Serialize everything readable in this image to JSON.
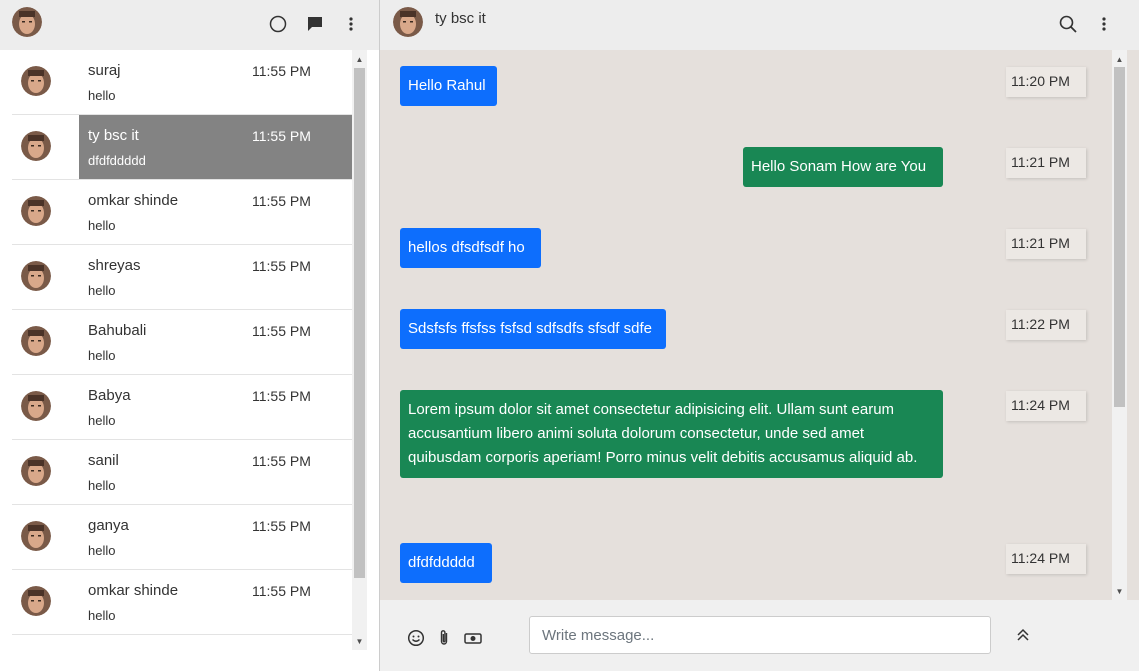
{
  "user": {
    "avatar_icon": "user-avatar"
  },
  "left_header": {
    "icons": [
      "status-icon",
      "new-chat-icon",
      "menu-icon"
    ]
  },
  "chats": [
    {
      "name": "suraj",
      "time": "11:55 PM",
      "last": "hello",
      "active": false
    },
    {
      "name": "ty bsc it",
      "time": "11:55 PM",
      "last": "dfdfddddd",
      "active": true
    },
    {
      "name": "omkar shinde",
      "time": "11:55 PM",
      "last": "hello",
      "active": false
    },
    {
      "name": "shreyas",
      "time": "11:55 PM",
      "last": "hello",
      "active": false
    },
    {
      "name": "Bahubali",
      "time": "11:55 PM",
      "last": "hello",
      "active": false
    },
    {
      "name": "Babya",
      "time": "11:55 PM",
      "last": "hello",
      "active": false
    },
    {
      "name": "sanil",
      "time": "11:55 PM",
      "last": "hello",
      "active": false
    },
    {
      "name": "ganya",
      "time": "11:55 PM",
      "last": "hello",
      "active": false
    },
    {
      "name": "omkar shinde",
      "time": "11:55 PM",
      "last": "hello",
      "active": false
    }
  ],
  "conversation": {
    "title": "ty bsc it",
    "messages": [
      {
        "text": "Hello Rahul",
        "time": "11:20 PM",
        "color": "#0d6efd"
      },
      {
        "text": "Hello Sonam How are You",
        "time": "11:21 PM",
        "color": "#198754"
      },
      {
        "text": "hellos dfsdfsdf ho",
        "time": "11:21 PM",
        "color": "#0d6efd"
      },
      {
        "text": "Sdsfsfs ffsfss fsfsd sdfsdfs sfsdf sdfe",
        "time": "11:22 PM",
        "color": "#0d6efd"
      },
      {
        "text": "Lorem ipsum dolor sit amet consectetur adipisicing elit. Ullam sunt earum accusantium libero animi soluta dolorum consectetur, unde sed amet quibusdam corporis aperiam! Porro minus velit debitis accusamus aliquid ab.",
        "time": "11:24 PM",
        "color": "#198754"
      },
      {
        "text": "dfdfddddd",
        "time": "11:24 PM",
        "color": "#0d6efd"
      }
    ]
  },
  "composer": {
    "placeholder": "Write message...",
    "icons": [
      "emoji-icon",
      "attach-icon",
      "camera-icon",
      "send-icon"
    ]
  },
  "colors": {
    "sent_blue": "#0d6efd",
    "sent_green": "#198754",
    "chat_bg": "#e5e0dc",
    "active_item": "#838383"
  }
}
